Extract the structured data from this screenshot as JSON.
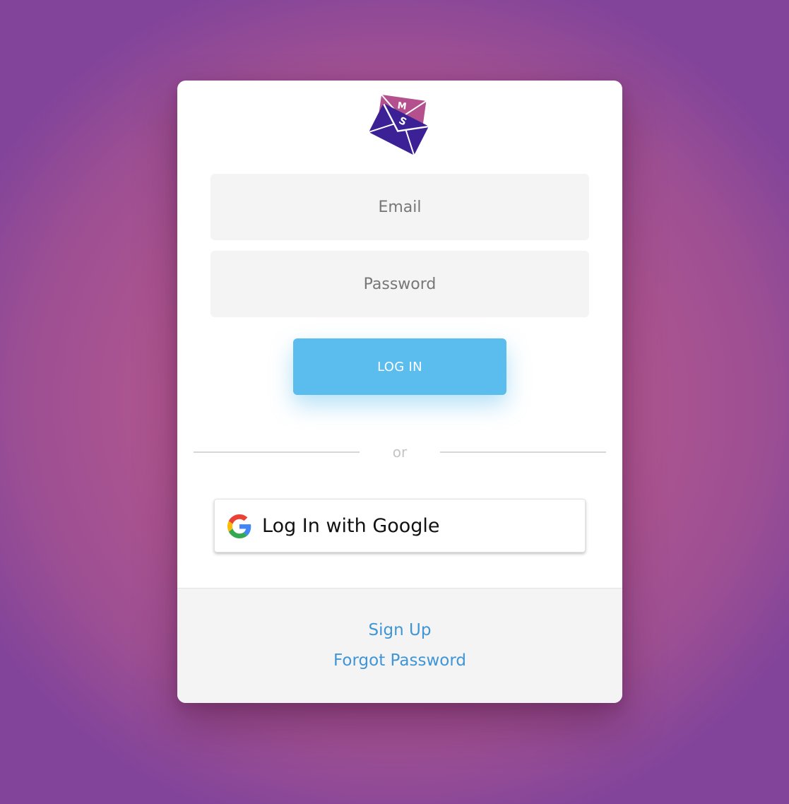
{
  "logo": {
    "icon": "envelope-logo-icon",
    "back_letter": "M",
    "front_letter": "S",
    "colors": {
      "back_envelope": "#b5508e",
      "front_envelope": "#3b2096"
    }
  },
  "form": {
    "email_placeholder": "Email",
    "password_placeholder": "Password",
    "login_label": "LOG IN",
    "divider_text": "or",
    "google_label": "Log In with Google",
    "google_icon": "google-g-icon"
  },
  "footer": {
    "signup_label": "Sign Up",
    "forgot_label": "Forgot Password"
  },
  "colors": {
    "background": "#b1568f",
    "primary_button": "#5bbcee",
    "link": "#3f95d6"
  }
}
